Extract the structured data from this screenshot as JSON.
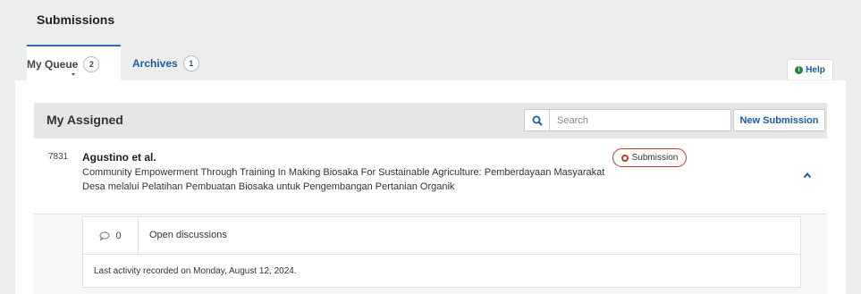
{
  "page": {
    "title": "Submissions"
  },
  "tabs": [
    {
      "label": "My Queue",
      "count": "2"
    },
    {
      "label": "Archives",
      "count": "1"
    }
  ],
  "help": {
    "label": "Help",
    "icon": "info-icon",
    "icon_glyph": "i"
  },
  "list": {
    "title": "My Assigned",
    "search_placeholder": "Search",
    "new_submission_label": "New Submission"
  },
  "submission": {
    "id": "7831",
    "authors": "Agustino et al.",
    "title": "Community Empowerment Through Training In Making Biosaka For Sustainable Agriculture: Pemberdayaan Masyarakat Desa melalui Pelatihan Pembuatan Biosaka untuk Pengembangan Pertanian Organik",
    "stage": "Submission",
    "discussion_count": "0",
    "discussion_label": "Open discussions",
    "last_activity": "Last activity recorded on Monday, August 12, 2024."
  },
  "colors": {
    "accent": "#1a5ca0",
    "stage_badge": "#c0392b",
    "help_icon": "#1f8a3b"
  }
}
